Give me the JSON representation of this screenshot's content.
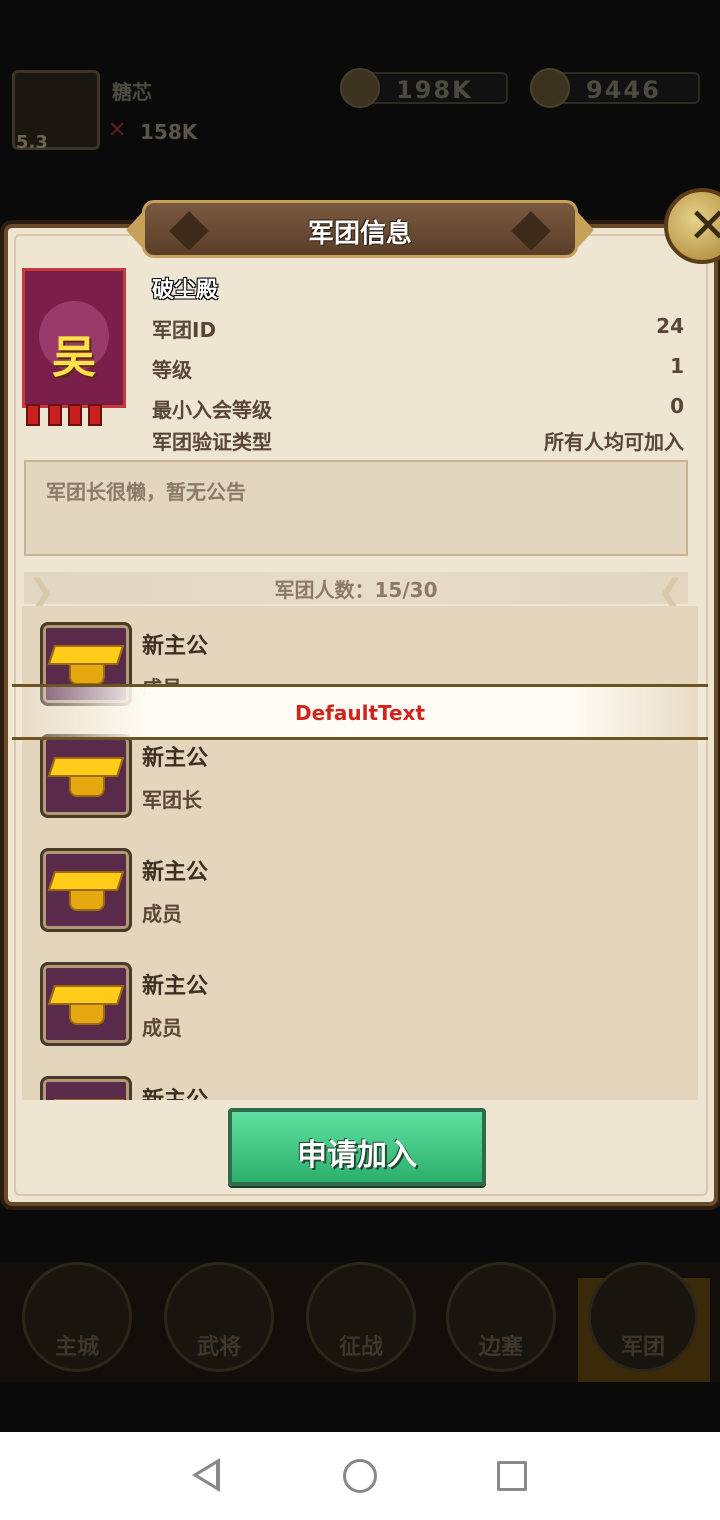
{
  "player": {
    "name": "糖芯",
    "level": "5.3",
    "power": "158K",
    "power_icon": "war-flag-icon"
  },
  "resources": {
    "coin": "198K",
    "ingot": "9446"
  },
  "nav": {
    "items": [
      "主城",
      "武将",
      "征战",
      "边塞",
      "军团"
    ],
    "active": "军团"
  },
  "dialog": {
    "title": "军团信息",
    "guild": {
      "name": "破尘殿",
      "flag_char": "吴",
      "id_label": "军团ID",
      "id_value": "24",
      "level_label": "等级",
      "level_value": "1",
      "min_level_label": "最小入会等级",
      "min_level_value": "0",
      "verify_label": "军团验证类型",
      "verify_value": "所有人均可加入"
    },
    "notice": "军团长很懒，暂无公告",
    "member_count": "军团人数：15/30",
    "members": [
      {
        "name": "新主公",
        "role": "成员"
      },
      {
        "name": "新主公",
        "role": "军团长"
      },
      {
        "name": "新主公",
        "role": "成员"
      },
      {
        "name": "新主公",
        "role": "成员"
      },
      {
        "name": "新主公",
        "role": ""
      }
    ],
    "toast": "DefaultText",
    "join_button": "申请加入"
  },
  "colors": {
    "accent": "#2bb06a",
    "toast_text": "#d2241d",
    "frame": "#6b4a2a"
  }
}
